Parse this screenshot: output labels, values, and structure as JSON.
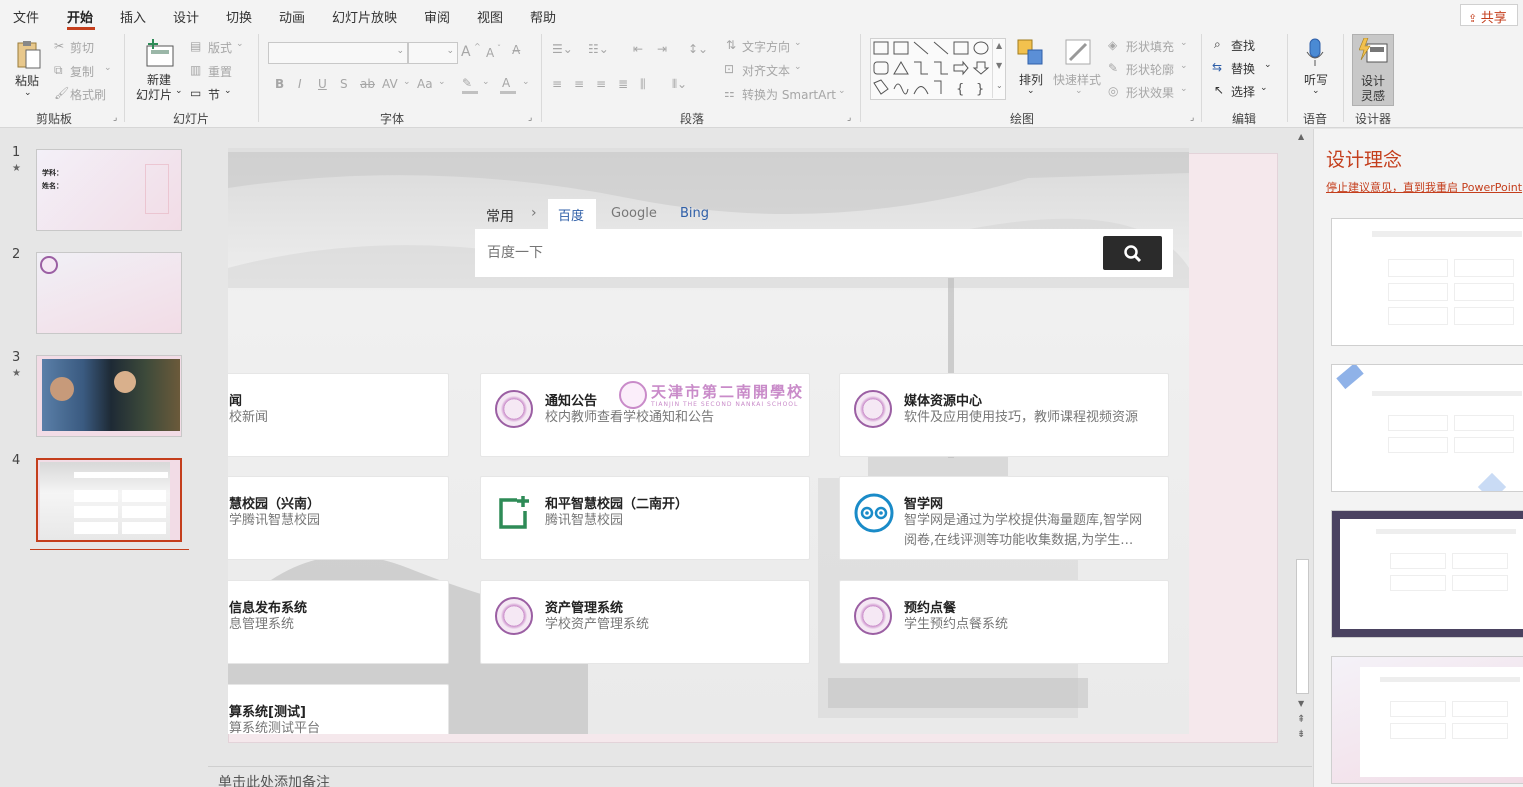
{
  "menu": [
    "文件",
    "开始",
    "插入",
    "设计",
    "切换",
    "动画",
    "幻灯片放映",
    "审阅",
    "视图",
    "帮助"
  ],
  "share": "共享",
  "ribbon": {
    "clipboard": {
      "paste": "粘贴",
      "cut": "剪切",
      "copy": "复制",
      "format_painter": "格式刷",
      "label": "剪贴板"
    },
    "slides": {
      "new_slide_line1": "新建",
      "new_slide_line2": "幻灯片",
      "layout": "版式",
      "reset": "重置",
      "section": "节",
      "label": "幻灯片"
    },
    "font": {
      "label": "字体",
      "bold": "B",
      "italic": "I",
      "underline": "U",
      "shadow": "S",
      "strike": "ab",
      "spacing": "AV",
      "case": "Aa",
      "fontcolor": "A",
      "grow": "A",
      "shrink": "A"
    },
    "paragraph": {
      "text_direction": "文字方向",
      "align_text": "对齐文本",
      "smartart": "转换为 SmartArt",
      "label": "段落"
    },
    "drawing": {
      "arrange": "排列",
      "quick_styles": "快速样式",
      "shape_fill": "形状填充",
      "shape_outline": "形状轮廓",
      "shape_effects": "形状效果",
      "label": "绘图"
    },
    "editing": {
      "find": "查找",
      "replace": "替换",
      "select": "选择",
      "label": "编辑"
    },
    "voice": {
      "dictate": "听写",
      "label": "语音"
    },
    "designer": {
      "ideas_line1": "设计",
      "ideas_line2": "灵感",
      "label": "设计器"
    }
  },
  "thumbnails": [
    {
      "num": "1",
      "star": "★",
      "line1": "学科：",
      "line2": "姓名："
    },
    {
      "num": "2",
      "star": ""
    },
    {
      "num": "3",
      "star": "★"
    },
    {
      "num": "4",
      "star": ""
    }
  ],
  "slide": {
    "tabs": {
      "common": "常用",
      "sep": "›",
      "baidu": "百度",
      "google": "Google",
      "bing": "Bing"
    },
    "search": {
      "placeholder": "百度一下"
    },
    "school_logo_text": "天津市第二南開學校",
    "school_logo_sub": "TIANJIN THE SECOND NANKAI SCHOOL",
    "cards": [
      {
        "title": "闻",
        "sub": "校新闻"
      },
      {
        "title": "通知公告",
        "sub": "校内教师查看学校通知和公告"
      },
      {
        "title": "媒体资源中心",
        "sub": "软件及应用使用技巧，教师课程视频资源"
      },
      {
        "title": "慧校园（兴南）",
        "sub": "学腾讯智慧校园"
      },
      {
        "title": "和平智慧校园（二南开）",
        "sub": "腾讯智慧校园"
      },
      {
        "title": "智学网",
        "sub": "智学网是通过为学校提供海量题库,智学网",
        "sub2": "阅卷,在线评测等功能收集数据,为学生…"
      },
      {
        "title": "信息发布系统",
        "sub": "息管理系统"
      },
      {
        "title": "资产管理系统",
        "sub": "学校资产管理系统"
      },
      {
        "title": "预约点餐",
        "sub": "学生预约点餐系统"
      },
      {
        "title": "算系统[测试]",
        "sub": "算系统测试平台"
      }
    ]
  },
  "notes_placeholder": "单击此处添加备注",
  "design_pane": {
    "title": "设计理念",
    "link": "停止建议意见，直到我重启 PowerPoint"
  },
  "colors": {
    "accent": "#c43e1c",
    "search_btn": "#2b2b2b",
    "baidu_tab": "#2f5fa8"
  }
}
